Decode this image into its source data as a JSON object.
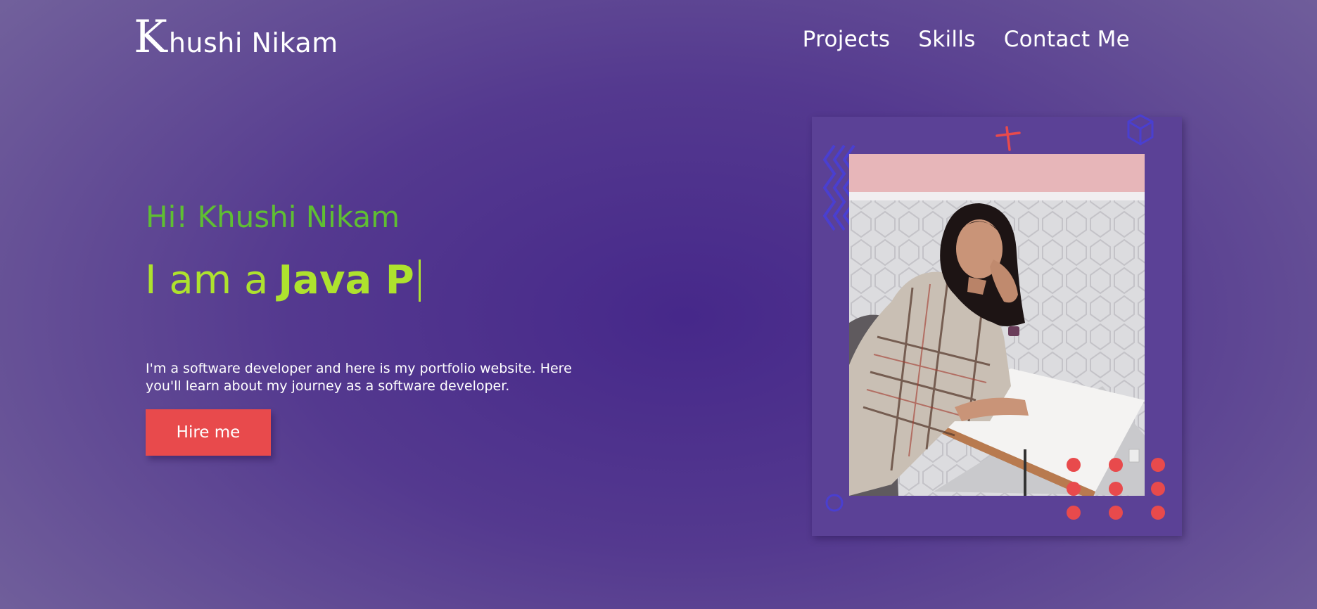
{
  "header": {
    "logo_initial": "K",
    "logo_rest": "hushi Nikam",
    "nav": [
      {
        "label": "Projects"
      },
      {
        "label": "Skills"
      },
      {
        "label": "Contact Me"
      }
    ]
  },
  "hero": {
    "greeting": "Hi! Khushi Nikam",
    "role_prefix": "I am a",
    "role_typed": "Java P",
    "intro": "I'm a software developer and here is my portfolio website. Here you'll learn about my journey as a software developer.",
    "cta_label": "Hire me"
  },
  "colors": {
    "greeting": "#5fbf32",
    "role": "#aee22e",
    "cta": "#e84a4c",
    "card": "#5b4196"
  },
  "icons": [
    "zigzag-icon",
    "plus-icon",
    "cube-icon",
    "circle-icon",
    "dot-grid-icon"
  ]
}
